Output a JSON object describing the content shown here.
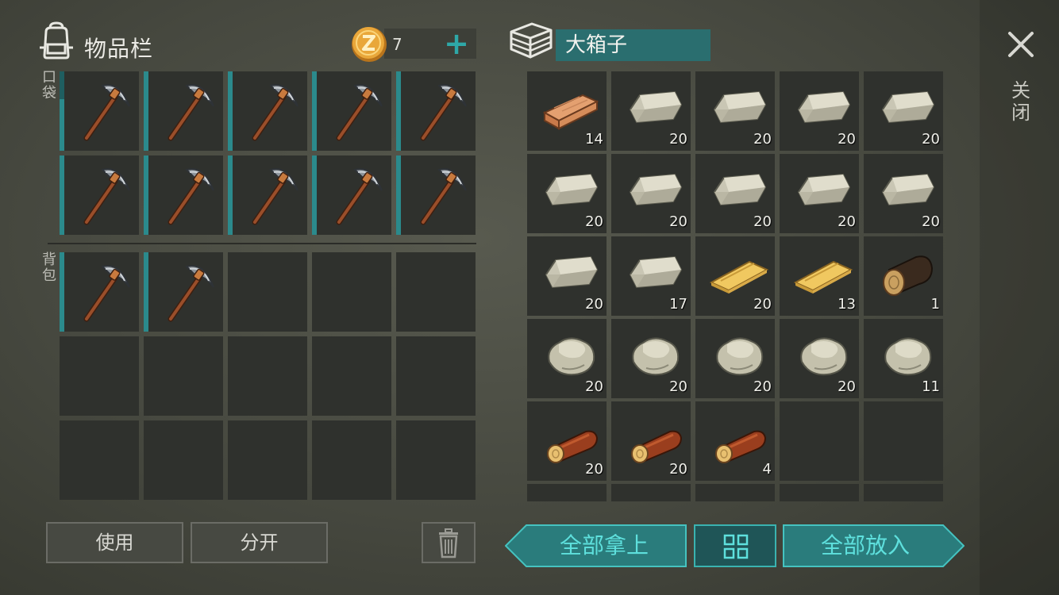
{
  "inventory": {
    "title": "物品栏",
    "coin_count": "7",
    "coin_add": "+",
    "pocket_label": "口袋",
    "bag_label": "背包",
    "pocket_slots": [
      {
        "item": "pickaxe",
        "durability": 0.65
      },
      {
        "item": "pickaxe",
        "durability": 1.0
      },
      {
        "item": "pickaxe",
        "durability": 1.0
      },
      {
        "item": "pickaxe",
        "durability": 1.0
      },
      {
        "item": "pickaxe",
        "durability": 1.0
      },
      {
        "item": "pickaxe",
        "durability": 1.0
      },
      {
        "item": "pickaxe",
        "durability": 1.0
      },
      {
        "item": "pickaxe",
        "durability": 1.0
      },
      {
        "item": "pickaxe",
        "durability": 1.0
      },
      {
        "item": "pickaxe",
        "durability": 1.0
      }
    ],
    "bag_slots": [
      {
        "item": "pickaxe",
        "durability": 1.0
      },
      {
        "item": "pickaxe",
        "durability": 1.0
      },
      {
        "item": ""
      },
      {
        "item": ""
      },
      {
        "item": ""
      },
      {
        "item": ""
      },
      {
        "item": ""
      },
      {
        "item": ""
      },
      {
        "item": ""
      },
      {
        "item": ""
      },
      {
        "item": ""
      },
      {
        "item": ""
      },
      {
        "item": ""
      },
      {
        "item": ""
      },
      {
        "item": ""
      }
    ]
  },
  "chest": {
    "title": "大箱子",
    "slots": [
      {
        "item": "plank",
        "count": "14"
      },
      {
        "item": "stone-block",
        "count": "20"
      },
      {
        "item": "stone-block",
        "count": "20"
      },
      {
        "item": "stone-block",
        "count": "20"
      },
      {
        "item": "stone-block",
        "count": "20"
      },
      {
        "item": "stone-block",
        "count": "20"
      },
      {
        "item": "stone-block",
        "count": "20"
      },
      {
        "item": "stone-block",
        "count": "20"
      },
      {
        "item": "stone-block",
        "count": "20"
      },
      {
        "item": "stone-block",
        "count": "20"
      },
      {
        "item": "stone-block",
        "count": "20"
      },
      {
        "item": "stone-block",
        "count": "17"
      },
      {
        "item": "board",
        "count": "20"
      },
      {
        "item": "board",
        "count": "13"
      },
      {
        "item": "dark-log",
        "count": "1"
      },
      {
        "item": "stone",
        "count": "20"
      },
      {
        "item": "stone",
        "count": "20"
      },
      {
        "item": "stone",
        "count": "20"
      },
      {
        "item": "stone",
        "count": "20"
      },
      {
        "item": "stone",
        "count": "11"
      },
      {
        "item": "log",
        "count": "20"
      },
      {
        "item": "log",
        "count": "20"
      },
      {
        "item": "log",
        "count": "4"
      },
      {
        "item": "",
        "count": ""
      },
      {
        "item": "",
        "count": ""
      }
    ],
    "partial_row_slots": 5
  },
  "buttons": {
    "use": "使用",
    "split": "分开",
    "take_all": "全部拿上",
    "put_all": "全部放入",
    "close_label": "关闭"
  },
  "icons": {
    "backpack": "backpack-icon",
    "coin": "coin-icon",
    "chest": "chest-icon",
    "close": "close-icon",
    "trash": "trash-icon",
    "sort": "grid-sort-icon"
  },
  "colors": {
    "accent_teal": "#2ea8a8",
    "title_bg": "#2a6e6f",
    "slot_bg": "#2f312d",
    "button_text_teal": "#5ee0dd"
  }
}
